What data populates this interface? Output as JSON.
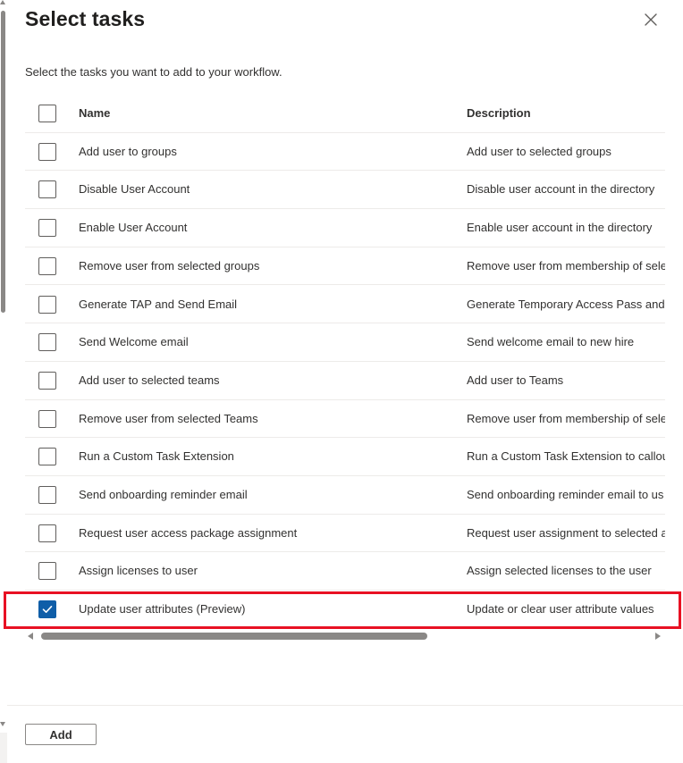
{
  "panel": {
    "title": "Select tasks",
    "subtitle": "Select the tasks you want to add to your workflow."
  },
  "table": {
    "columns": [
      "Name",
      "Description"
    ],
    "rows": [
      {
        "name": "Add user to groups",
        "description": "Add user to selected groups",
        "checked": false
      },
      {
        "name": "Disable User Account",
        "description": "Disable user account in the directory",
        "checked": false
      },
      {
        "name": "Enable User Account",
        "description": "Enable user account in the directory",
        "checked": false
      },
      {
        "name": "Remove user from selected groups",
        "description": "Remove user from membership of sele",
        "checked": false
      },
      {
        "name": "Generate TAP and Send Email",
        "description": "Generate Temporary Access Pass and se",
        "checked": false
      },
      {
        "name": "Send Welcome email",
        "description": "Send welcome email to new hire",
        "checked": false
      },
      {
        "name": "Add user to selected teams",
        "description": "Add user to Teams",
        "checked": false
      },
      {
        "name": "Remove user from selected Teams",
        "description": "Remove user from membership of sele",
        "checked": false
      },
      {
        "name": "Run a Custom Task Extension",
        "description": "Run a Custom Task Extension to callout",
        "checked": false
      },
      {
        "name": "Send onboarding reminder email",
        "description": "Send onboarding reminder email to us",
        "checked": false
      },
      {
        "name": "Request user access package assignment",
        "description": "Request user assignment to selected ac",
        "checked": false
      },
      {
        "name": "Assign licenses to user",
        "description": "Assign selected licenses to the user",
        "checked": false
      },
      {
        "name": "Update user attributes (Preview)",
        "description": "Update or clear user attribute values",
        "checked": true
      }
    ]
  },
  "footer": {
    "add_label": "Add"
  },
  "colors": {
    "accent": "#0f5ea8",
    "highlight": "#e81123"
  },
  "icons": {
    "close": "close-icon",
    "check": "checkmark-icon"
  }
}
